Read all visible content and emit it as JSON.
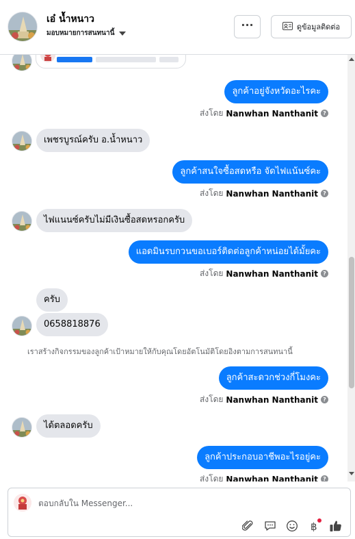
{
  "header": {
    "contact_name": "เอ๋ น้ำหนาว",
    "assign_label": "มอบหมายการสนทนานี้",
    "more_label": "···",
    "view_contact_label": "ดูข้อมูลติดต่อ"
  },
  "messages": [
    {
      "direction": "out",
      "text": "ลูกค้าอยู่จังหวัดอะไรคะ",
      "sent_by_label": "ส่งโดย",
      "sender": "Nanwhan Nanthanit"
    },
    {
      "direction": "in",
      "text": "เพชรบูรณ์ครับ อ.น้ำหนาว"
    },
    {
      "direction": "out",
      "text": "ลูกค้าสนใจซื้อสดหรือ จัดไฟแน้นซ์คะ",
      "sent_by_label": "ส่งโดย",
      "sender": "Nanwhan Nanthanit"
    },
    {
      "direction": "in",
      "text": "ไฟแนนซ์ครับไม่มีเงินซื้อสดหรอกครับ"
    },
    {
      "direction": "out",
      "text": "แอดมินรบกวนขอเบอร์ติดต่อลูกค้าหน่อยได้มั้ยคะ",
      "sent_by_label": "ส่งโดย",
      "sender": "Nanwhan Nanthanit"
    },
    {
      "direction": "in",
      "text": "ครับ"
    },
    {
      "direction": "in",
      "text": "0658818876"
    },
    {
      "direction": "system",
      "text": "เราสร้างกิจกรรมของลูกค้าเป้าหมายให้กับคุณโดยอัตโนมัติโดยอิงตามการสนทนานี้"
    },
    {
      "direction": "out",
      "text": "ลูกค้าสะดวกช่วงกี่โมงคะ",
      "sent_by_label": "ส่งโดย",
      "sender": "Nanwhan Nanthanit"
    },
    {
      "direction": "in",
      "text": "ได้ตลอดครับ"
    },
    {
      "direction": "out",
      "text": "ลูกค้าประกอบอาชีพอะไรอยู่คะ",
      "sent_by_label": "ส่งโดย",
      "sender": "Nanwhan Nanthanit"
    }
  ],
  "composer": {
    "placeholder": "ตอบกลับใน Messenger..."
  },
  "icons": {
    "attach": "paperclip-icon",
    "saved_reply": "speech-bubble-icon",
    "emoji": "smiley-icon",
    "payment": "baht-icon",
    "like": "thumbs-up-icon"
  },
  "colors": {
    "outgoing_bubble": "#0a7cff",
    "incoming_bubble": "#e4e6eb",
    "accent": "#1877f2"
  }
}
